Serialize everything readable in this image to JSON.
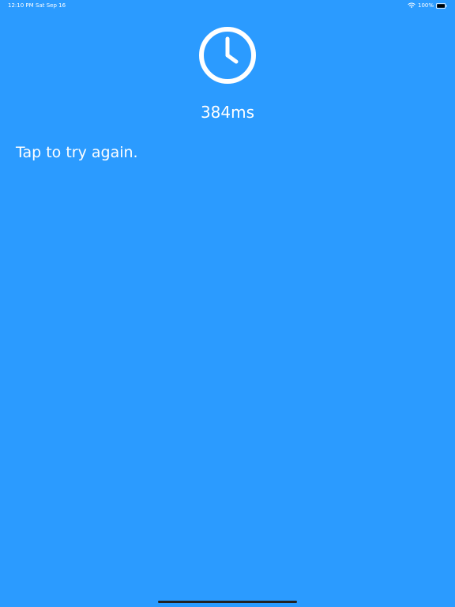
{
  "status_bar": {
    "time": "12:10 PM",
    "date": "Sat Sep 16",
    "battery": "100%",
    "wifi_icon": "wifi-icon",
    "battery_icon": "battery-icon"
  },
  "main": {
    "clock_icon": "clock-icon",
    "timer_value": "384ms",
    "message": "Tap to try again."
  },
  "colors": {
    "background": "#2b9bff",
    "foreground": "#ffffff",
    "home_indicator": "#222222"
  }
}
